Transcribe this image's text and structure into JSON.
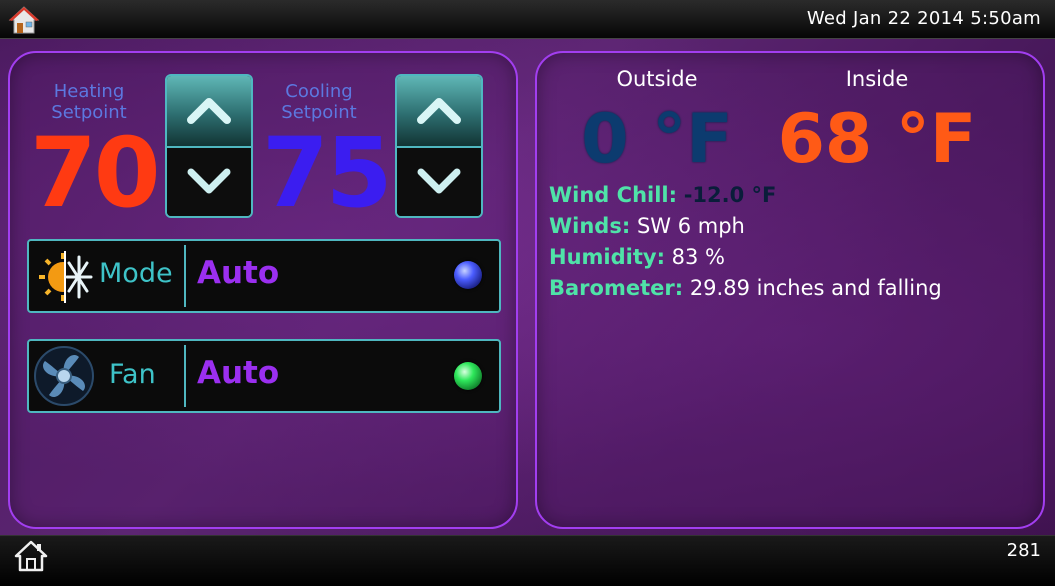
{
  "topbar": {
    "datetime": "Wed Jan 22 2014 5:50am",
    "home_icon": "house-icon"
  },
  "setpoints": {
    "heating": {
      "label_line1": "Heating",
      "label_line2": "Setpoint",
      "value": "70"
    },
    "cooling": {
      "label_line1": "Cooling",
      "label_line2": "Setpoint",
      "value": "75"
    }
  },
  "mode": {
    "label": "Mode",
    "value": "Auto",
    "icon": "sun-snowflake-icon",
    "indicator_color": "#4b5dff"
  },
  "fan": {
    "label": "Fan",
    "value": "Auto",
    "icon": "fan-icon",
    "indicator_color": "#2ee85b"
  },
  "weather": {
    "outside": {
      "label": "Outside",
      "temp": "0 °F"
    },
    "inside": {
      "label": "Inside",
      "temp": "68 °F"
    },
    "wind_chill": {
      "key": "Wind Chill:",
      "value": "-12.0 °F"
    },
    "winds": {
      "key": "Winds:",
      "value": "SW 6 mph"
    },
    "humidity": {
      "key": "Humidity:",
      "value": "83 %"
    },
    "barometer": {
      "key": "Barometer:",
      "value": "29.89 inches and falling"
    }
  },
  "bottombar": {
    "page_number": "281",
    "home_icon": "home-outline-icon"
  },
  "colors": {
    "accent_purple": "#a23ef0",
    "heating": "#ff3a12",
    "cooling": "#3b1df0",
    "teal": "#4fb7c0",
    "key_green": "#4fe3a8"
  }
}
